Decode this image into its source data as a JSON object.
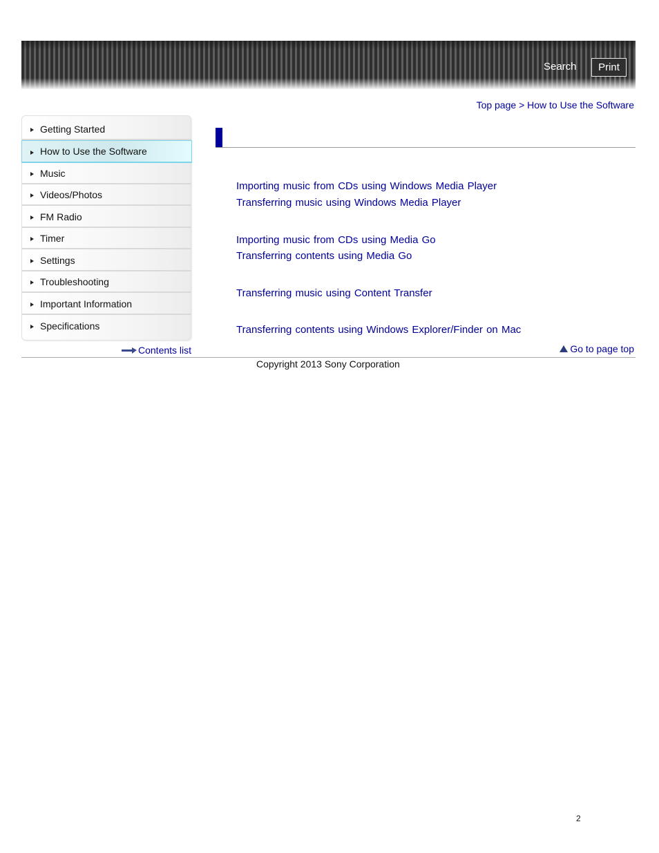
{
  "header": {
    "search_label": "Search",
    "print_label": "Print"
  },
  "breadcrumb": {
    "items": [
      "Top page",
      "How to Use the Software"
    ],
    "separator": ">"
  },
  "sidebar": {
    "items": [
      {
        "label": "Getting Started",
        "active": false
      },
      {
        "label": "How to Use the Software",
        "active": true
      },
      {
        "label": "Music",
        "active": false
      },
      {
        "label": "Videos/Photos",
        "active": false
      },
      {
        "label": "FM Radio",
        "active": false
      },
      {
        "label": "Timer",
        "active": false
      },
      {
        "label": "Settings",
        "active": false
      },
      {
        "label": "Troubleshooting",
        "active": false
      },
      {
        "label": "Important Information",
        "active": false
      },
      {
        "label": "Specifications",
        "active": false
      }
    ],
    "contents_list_label": "Contents list"
  },
  "main": {
    "title": "",
    "links": [
      "Importing music from CDs using Windows Media Player",
      "Transferring music using Windows Media Player",
      "Importing music from CDs using Media Go",
      "Transferring contents using Media Go",
      "Transferring music using Content Transfer",
      "Transferring contents using Windows Explorer/Finder on Mac"
    ],
    "page_top_label": "Go to page top"
  },
  "footer": {
    "copyright": "Copyright 2013 Sony Corporation",
    "page_number": "2"
  },
  "colors": {
    "link": "#000099",
    "active_nav": "#dff3f5",
    "active_nav_border": "#7fd4ea"
  }
}
